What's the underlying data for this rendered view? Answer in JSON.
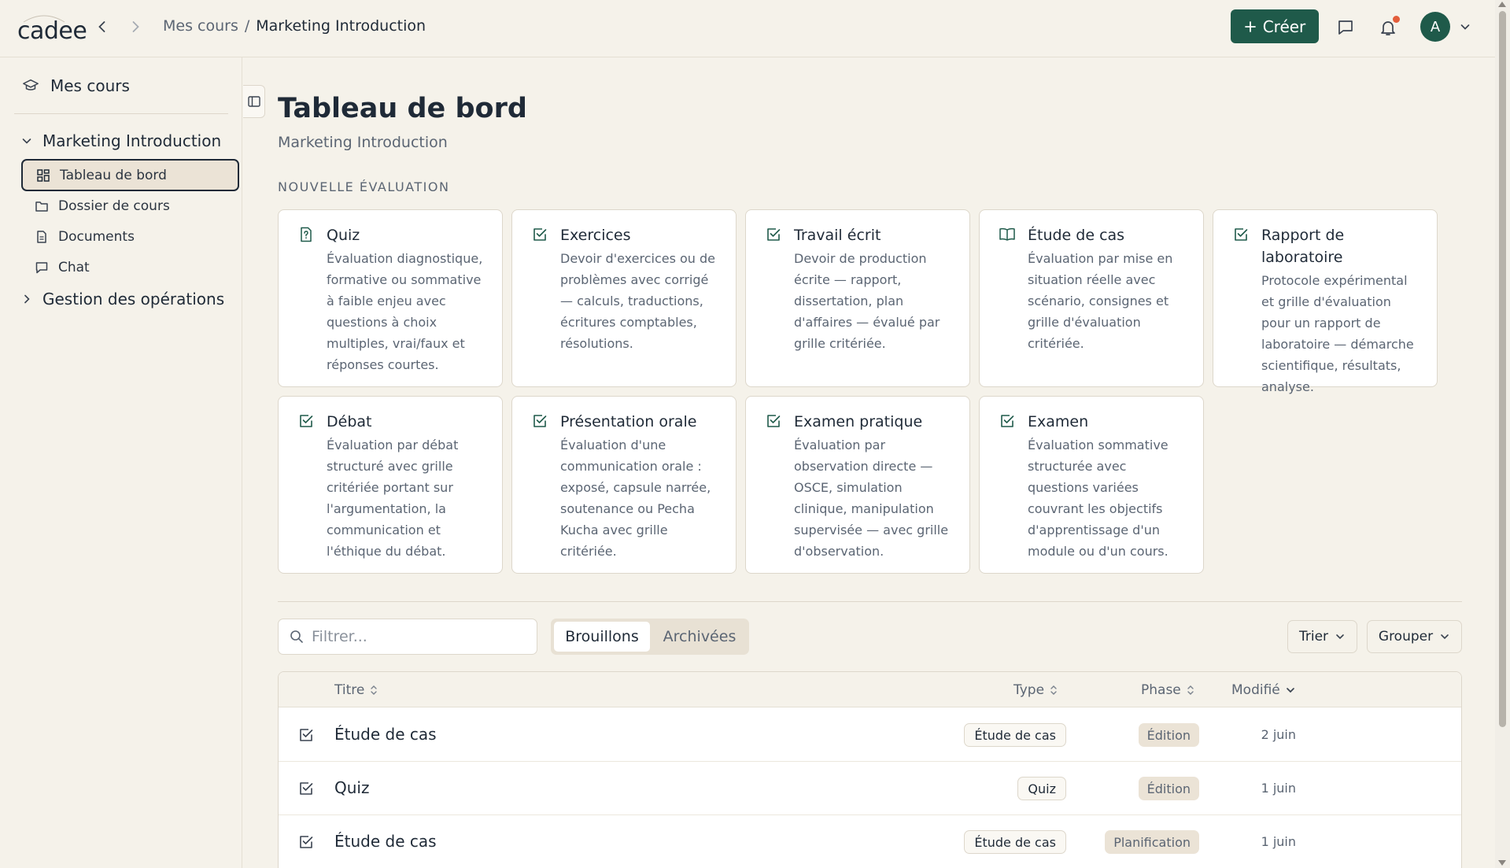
{
  "header": {
    "logo": "cadee",
    "breadcrumb_root": "Mes cours",
    "breadcrumb_sep": "/",
    "breadcrumb_current": "Marketing Introduction",
    "create_label": "Créer",
    "avatar_initial": "A"
  },
  "sidebar": {
    "top_label": "Mes cours",
    "course": "Marketing Introduction",
    "items": [
      {
        "label": "Tableau de bord",
        "icon": "dashboard-icon"
      },
      {
        "label": "Dossier de cours",
        "icon": "folder-icon"
      },
      {
        "label": "Documents",
        "icon": "document-icon"
      },
      {
        "label": "Chat",
        "icon": "chat-icon"
      }
    ],
    "group": "Gestion des opérations"
  },
  "main": {
    "title": "Tableau de bord",
    "subtitle": "Marketing Introduction",
    "section_label": "NOUVELLE ÉVALUATION",
    "cards": [
      {
        "title": "Quiz",
        "desc": "Évaluation diagnostique, formative ou sommative à faible enjeu avec questions à choix multiples, vrai/faux et réponses courtes.",
        "icon": "quiz-icon"
      },
      {
        "title": "Exercices",
        "desc": "Devoir d'exercices ou de problèmes avec corrigé — calculs, traductions, écritures comptables, résolutions.",
        "icon": "checkbox-icon"
      },
      {
        "title": "Travail écrit",
        "desc": "Devoir de production écrite — rapport, dissertation, plan d'affaires — évalué par grille critériée.",
        "icon": "checkbox-icon"
      },
      {
        "title": "Étude de cas",
        "desc": "Évaluation par mise en situation réelle avec scénario, consignes et grille d'évaluation critériée.",
        "icon": "book-icon"
      },
      {
        "title": "Rapport de laboratoire",
        "desc": "Protocole expérimental et grille d'évaluation pour un rapport de laboratoire — démarche scientifique, résultats, analyse.",
        "icon": "checkbox-icon"
      },
      {
        "title": "Débat",
        "desc": "Évaluation par débat structuré avec grille critériée portant sur l'argumentation, la communication et l'éthique du débat.",
        "icon": "checkbox-icon"
      },
      {
        "title": "Présentation orale",
        "desc": "Évaluation d'une communication orale : exposé, capsule narrée, soutenance ou Pecha Kucha avec grille critériée.",
        "icon": "checkbox-icon"
      },
      {
        "title": "Examen pratique",
        "desc": "Évaluation par observation directe — OSCE, simulation clinique, manipulation supervisée — avec grille d'observation.",
        "icon": "checkbox-icon"
      },
      {
        "title": "Examen",
        "desc": "Évaluation sommative structurée avec questions variées couvrant les objectifs d'apprentissage d'un module ou d'un cours.",
        "icon": "checkbox-icon"
      }
    ],
    "filter_placeholder": "Filtrer...",
    "tabs": [
      "Brouillons",
      "Archivées"
    ],
    "sort_label": "Trier",
    "group_label": "Grouper",
    "columns": {
      "title": "Titre",
      "type": "Type",
      "phase": "Phase",
      "modified": "Modifié"
    },
    "rows": [
      {
        "title": "Étude de cas",
        "type": "Étude de cas",
        "phase": "Édition",
        "date": "2 juin"
      },
      {
        "title": "Quiz",
        "type": "Quiz",
        "phase": "Édition",
        "date": "1 juin"
      },
      {
        "title": "Étude de cas",
        "type": "Étude de cas",
        "phase": "Planification",
        "date": "1 juin"
      }
    ]
  }
}
